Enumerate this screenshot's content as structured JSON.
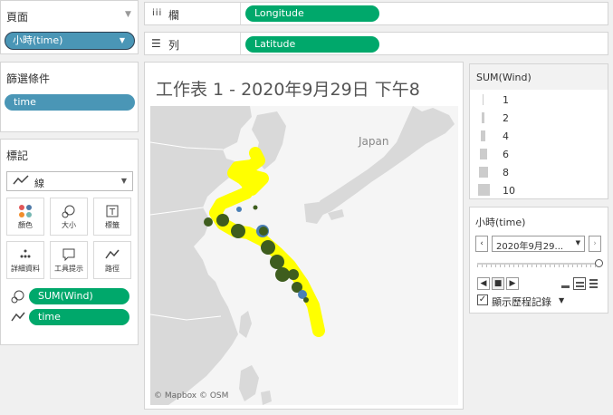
{
  "pages_panel": {
    "title": "頁面",
    "pill_label": "小時(time)"
  },
  "filters_panel": {
    "title": "篩選條件",
    "pill_label": "time"
  },
  "marks_panel": {
    "title": "標記",
    "mark_type": "線",
    "buttons": [
      {
        "label": "顏色",
        "icon": "color-dots-icon"
      },
      {
        "label": "大小",
        "icon": "size-icon"
      },
      {
        "label": "標籤",
        "icon": "label-icon"
      },
      {
        "label": "詳細資料",
        "icon": "detail-icon"
      },
      {
        "label": "工具提示",
        "icon": "tooltip-icon"
      },
      {
        "label": "路徑",
        "icon": "path-icon"
      }
    ],
    "pills": [
      {
        "label": "SUM(Wind)",
        "icon": "size-icon"
      },
      {
        "label": "time",
        "icon": "path-icon"
      }
    ]
  },
  "shelves": {
    "columns_label": "欄",
    "columns_pill": "Longitude",
    "rows_label": "列",
    "rows_pill": "Latitude"
  },
  "worksheet": {
    "title": "工作表 1 - 2020年9月29日 下午8",
    "map_label_japan": "Japan",
    "attribution": "© Mapbox © OSM"
  },
  "size_legend": {
    "title": "SUM(Wind)",
    "items": [
      "1",
      "2",
      "4",
      "6",
      "8",
      "10"
    ]
  },
  "page_control": {
    "title": "小時(time)",
    "current_value": "2020年9月29...",
    "show_history_label": "顯示歷程記錄",
    "show_history_checked": true
  },
  "colors": {
    "pill_green": "#00a86b",
    "pill_blue": "#4a96b6",
    "path_yellow": "#ffff00",
    "marker_green": "#3e5d1e",
    "marker_blue": "#4a7fb5"
  }
}
